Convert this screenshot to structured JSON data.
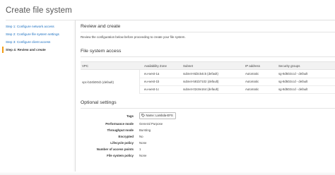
{
  "page": {
    "title": "Create file system"
  },
  "steps": [
    {
      "label": "Step 1: Configure network access",
      "active": false
    },
    {
      "label": "Step 2: Configure file system settings",
      "active": false
    },
    {
      "label": "Step 3: Configure client access",
      "active": false
    },
    {
      "label": "Step 4: Review and create",
      "active": true
    }
  ],
  "review": {
    "title": "Review and create",
    "description": "Review the configuration below before proceeding to create your file system."
  },
  "file_system_access": {
    "title": "File system access",
    "columns": [
      "VPC",
      "Availability Zone",
      "Subnet",
      "IP address",
      "Security groups"
    ],
    "vpc": "vpc-b24b00cb (default)",
    "rows": [
      {
        "zone": "eu-west-1a",
        "subnet": "subnet-8d3c54c5 (default)",
        "ip": "Automatic",
        "sg": "sg-8d502ccd - default"
      },
      {
        "zone": "eu-west-1b",
        "subnet": "subnet-581b7102 (default)",
        "ip": "Automatic",
        "sg": "sg-8d502ccd - default"
      },
      {
        "zone": "eu-west-1c",
        "subnet": "subnet-02c8e164 (default)",
        "ip": "Automatic",
        "sg": "sg-8d502ccd - default"
      }
    ]
  },
  "optional_settings": {
    "title": "Optional settings",
    "tags_label": "Tags",
    "tag_value": "Name: Lambda-EFS",
    "tag_icon": "tag-icon",
    "rows": [
      {
        "key": "Performance mode",
        "value": "General Purpose"
      },
      {
        "key": "Throughput mode",
        "value": "Bursting"
      },
      {
        "key": "Encrypted",
        "value": "No"
      },
      {
        "key": "Lifecycle policy",
        "value": "None"
      },
      {
        "key": "Number of access points",
        "value": "1"
      },
      {
        "key": "File system policy",
        "value": "None"
      }
    ]
  },
  "colors": {
    "link": "#1a6fc0",
    "active_marker": "#f39c12"
  }
}
